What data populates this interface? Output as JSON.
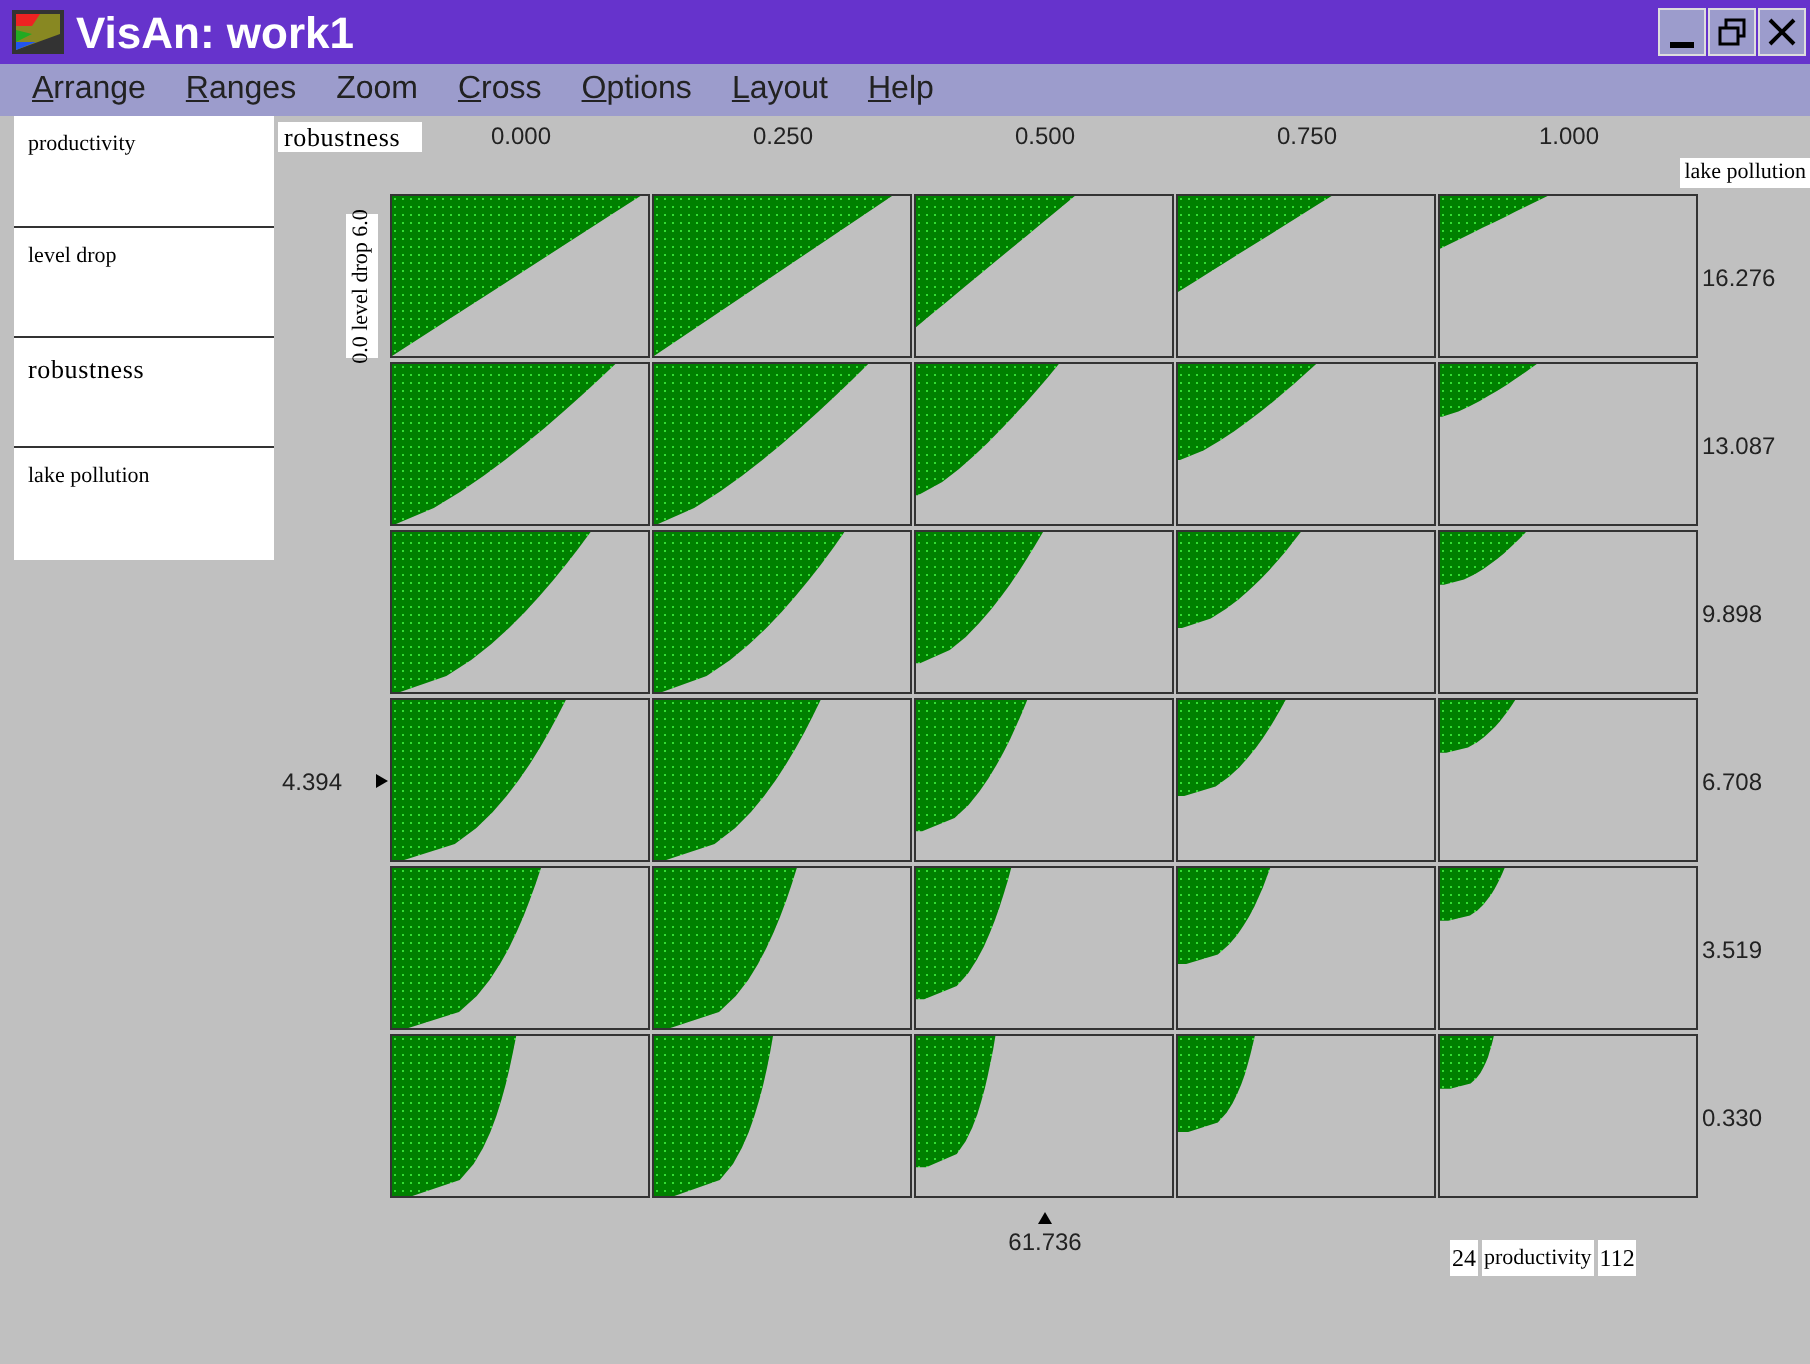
{
  "window": {
    "title": "VisAn: work1"
  },
  "menu": [
    {
      "label": "Arrange",
      "underline_first": true
    },
    {
      "label": "Ranges",
      "underline_first": true
    },
    {
      "label": "Zoom",
      "underline_first": false
    },
    {
      "label": "Cross",
      "underline_first": true
    },
    {
      "label": "Options",
      "underline_first": true
    },
    {
      "label": "Layout",
      "underline_first": true
    },
    {
      "label": "Help",
      "underline_first": true
    }
  ],
  "attributes": [
    "productivity",
    "level drop",
    "robustness",
    "lake pollution"
  ],
  "plot": {
    "column_variable": "robustness",
    "columns": [
      {
        "value": "0.000"
      },
      {
        "value": "0.250"
      },
      {
        "value": "0.500",
        "marker": "61.736"
      },
      {
        "value": "0.750"
      },
      {
        "value": "1.000"
      }
    ],
    "row_variable": "lake pollution",
    "rows": [
      {
        "value": "16.276"
      },
      {
        "value": "13.087"
      },
      {
        "value": "9.898"
      },
      {
        "value": "6.708",
        "marker": "4.394"
      },
      {
        "value": "3.519"
      },
      {
        "value": "0.330"
      }
    ],
    "cell_axis_label": "0.0 level drop 6.0",
    "color_range": {
      "min": "24",
      "variable": "productivity",
      "max": "112"
    }
  }
}
